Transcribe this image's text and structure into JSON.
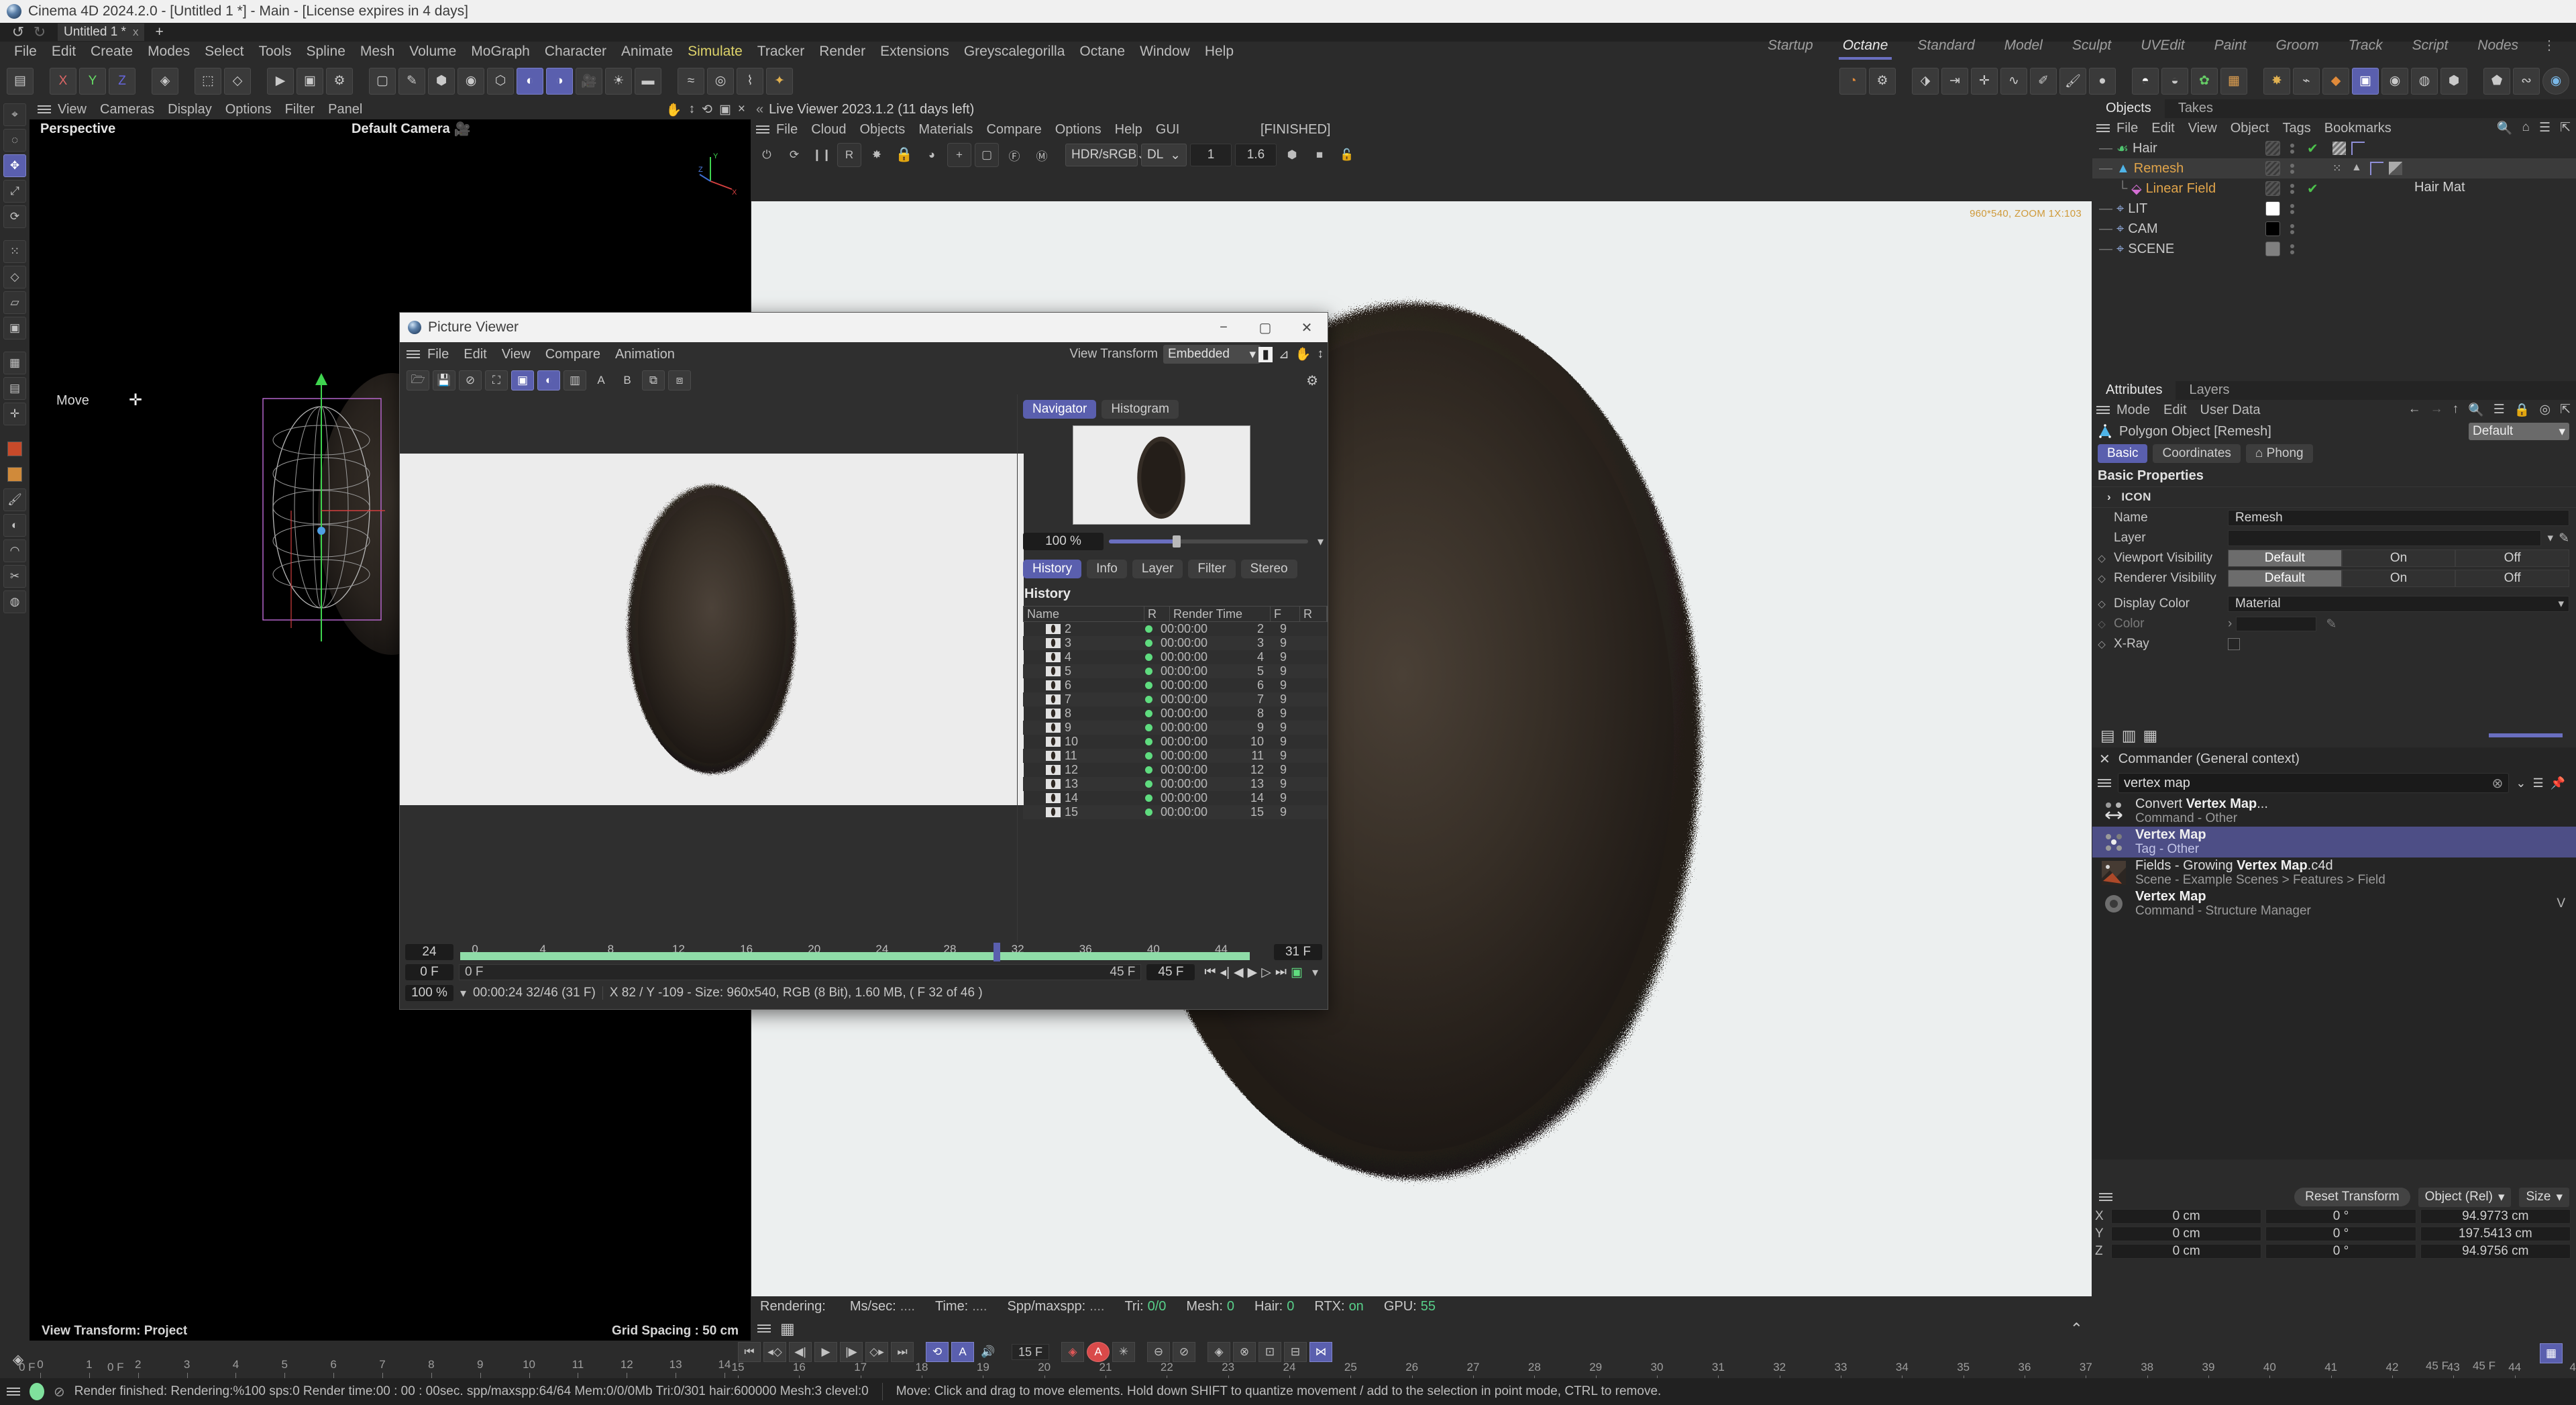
{
  "title_bar": {
    "text": "Cinema 4D 2024.2.0 - [Untitled 1 *] - Main - [License expires in 4 days]"
  },
  "doc_tabs": {
    "name": "Untitled 1 *",
    "close": "x",
    "add": "+",
    "undo": "↺",
    "redo": "↻"
  },
  "main_menu": [
    "File",
    "Edit",
    "Create",
    "Modes",
    "Select",
    "Tools",
    "Spline",
    "Mesh",
    "Volume",
    "MoGraph",
    "Character",
    "Animate",
    "Simulate",
    "Tracker",
    "Render",
    "Extensions",
    "Greyscalegorilla",
    "Octane",
    "Window",
    "Help"
  ],
  "main_menu_active": "Simulate",
  "layout_tabs": [
    "Startup",
    "Octane",
    "Standard",
    "Model",
    "Sculpt",
    "UVEdit",
    "Paint",
    "Groom",
    "Track",
    "Script",
    "Nodes"
  ],
  "layout_active": "Octane",
  "viewport": {
    "menu": [
      "View",
      "Cameras",
      "Display",
      "Options",
      "Filter",
      "Panel"
    ],
    "projection": "Perspective",
    "camera": "Default Camera",
    "tool_label": "Move",
    "view_transform": "View Transform: Project",
    "grid_spacing": "Grid Spacing : 50 cm"
  },
  "live_viewer": {
    "title": "Live Viewer 2023.1.2 (11 days left)",
    "menu": [
      "File",
      "Cloud",
      "Objects",
      "Materials",
      "Compare",
      "Options",
      "Help",
      "GUI"
    ],
    "status": "[FINISHED]",
    "color_space": "HDR/sRGB",
    "kernel": "DL",
    "num1": "1",
    "num2": "1.6",
    "watermark": "960*540, ZOOM 1X:103",
    "stats": {
      "rendering_label": "Rendering:",
      "rendering_value": "",
      "mssec_label": "Ms/sec:",
      "mssec_value": "....",
      "time_label": "Time:",
      "time_value": "....",
      "spp_label": "Spp/maxspp:",
      "spp_value": "....",
      "tri_label": "Tri:",
      "tri_value": "0/0",
      "mesh_label": "Mesh:",
      "mesh_value": "0",
      "hair_label": "Hair:",
      "hair_value": "0",
      "rtx_label": "RTX:",
      "rtx_value": "on",
      "gpu_label": "GPU:",
      "gpu_value": "55"
    }
  },
  "picture_viewer": {
    "window_title": "Picture Viewer",
    "menu": [
      "File",
      "Edit",
      "View",
      "Compare",
      "Animation"
    ],
    "view_transform_label": "View Transform",
    "view_transform_value": "Embedded",
    "nav_tabs": [
      "Navigator",
      "Histogram"
    ],
    "nav_active": "Navigator",
    "zoom_value": "100 %",
    "info_tabs": [
      "History",
      "Info",
      "Layer",
      "Filter",
      "Stereo"
    ],
    "info_active": "History",
    "history_title": "History",
    "history_columns": [
      "Name",
      "R",
      "Render Time",
      "F",
      "R"
    ],
    "history_rows": [
      {
        "name": "2",
        "time": "00:00:00",
        "f": "2",
        "r": "9"
      },
      {
        "name": "3",
        "time": "00:00:00",
        "f": "3",
        "r": "9"
      },
      {
        "name": "4",
        "time": "00:00:00",
        "f": "4",
        "r": "9"
      },
      {
        "name": "5",
        "time": "00:00:00",
        "f": "5",
        "r": "9"
      },
      {
        "name": "6",
        "time": "00:00:00",
        "f": "6",
        "r": "9"
      },
      {
        "name": "7",
        "time": "00:00:00",
        "f": "7",
        "r": "9"
      },
      {
        "name": "8",
        "time": "00:00:00",
        "f": "8",
        "r": "9"
      },
      {
        "name": "9",
        "time": "00:00:00",
        "f": "9",
        "r": "9"
      },
      {
        "name": "10",
        "time": "00:00:00",
        "f": "10",
        "r": "9"
      },
      {
        "name": "11",
        "time": "00:00:00",
        "f": "11",
        "r": "9"
      },
      {
        "name": "12",
        "time": "00:00:00",
        "f": "12",
        "r": "9"
      },
      {
        "name": "13",
        "time": "00:00:00",
        "f": "13",
        "r": "9"
      },
      {
        "name": "14",
        "time": "00:00:00",
        "f": "14",
        "r": "9"
      },
      {
        "name": "15",
        "time": "00:00:00",
        "f": "15",
        "r": "9"
      }
    ],
    "timeline": {
      "fps": "24",
      "current_frame": "31 F",
      "start": "0 F",
      "end": "45 F",
      "range_start": "0 F",
      "range_end": "45 F",
      "ticks": [
        "0",
        "4",
        "8",
        "12",
        "16",
        "20",
        "24",
        "28",
        "32",
        "36",
        "40",
        "44"
      ],
      "playhead_label": "31"
    },
    "status": {
      "zoom": "100 %",
      "time": "00:00:24 32/46 (31 F)",
      "info": "X 82 / Y -109 - Size: 960x540, RGB (8 Bit), 1.60 MB,  ( F 32 of 46 )"
    }
  },
  "object_manager": {
    "tabs": [
      "Objects",
      "Takes"
    ],
    "active_tab": "Objects",
    "menu": [
      "File",
      "Edit",
      "View",
      "Object",
      "Tags",
      "Bookmarks"
    ],
    "items": [
      {
        "name": "Hair",
        "indent": 0,
        "selected": false,
        "check": true,
        "swatch": "hatch"
      },
      {
        "name": "Remesh",
        "indent": 0,
        "selected": true,
        "check": false,
        "swatch": "hatch"
      },
      {
        "name": "Linear Field",
        "indent": 1,
        "selected": false,
        "check": true,
        "swatch": "hatch"
      },
      {
        "name": "LIT",
        "indent": 0,
        "selected": false,
        "check": false,
        "swatch": "#ffffff"
      },
      {
        "name": "CAM",
        "indent": 0,
        "selected": false,
        "check": false,
        "swatch": "#000000"
      },
      {
        "name": "SCENE",
        "indent": 0,
        "selected": false,
        "check": false,
        "swatch": "#808080"
      }
    ],
    "material_label": "Hair Mat"
  },
  "attributes": {
    "tabs": [
      "Attributes",
      "Layers"
    ],
    "active_tab": "Attributes",
    "menu": [
      "Mode",
      "Edit",
      "User Data"
    ],
    "object_title": "Polygon Object [Remesh]",
    "preset": "Default",
    "pills": [
      "Basic",
      "Coordinates",
      "Phong"
    ],
    "pill_active": "Basic",
    "section": "Basic Properties",
    "icon_section": "ICON",
    "rows": {
      "name_label": "Name",
      "name_value": "Remesh",
      "layer_label": "Layer",
      "layer_value": "",
      "viewport_vis_label": "Viewport Visibility",
      "renderer_vis_label": "Renderer Visibility",
      "seg_options": [
        "Default",
        "On",
        "Off"
      ],
      "seg_active": "Default",
      "display_color_label": "Display Color",
      "display_color_value": "Material",
      "color_label": "Color",
      "xray_label": "X-Ray"
    }
  },
  "commander": {
    "title": "Commander (General context)",
    "query": "vertex map",
    "results": [
      {
        "title_pre": "Convert ",
        "title_bold": "Vertex Map",
        "title_post": "...",
        "sub": "Command - Other",
        "selected": false,
        "icon": "convert",
        "shortcut": ""
      },
      {
        "title_pre": "",
        "title_bold": "Vertex Map",
        "title_post": "",
        "sub": "Tag - Other",
        "selected": true,
        "icon": "dots",
        "shortcut": ""
      },
      {
        "title_pre": "Fields - Growing ",
        "title_bold": "Vertex Map",
        "title_post": ".c4d",
        "sub": "Scene - Example Scenes > Features > Field",
        "selected": false,
        "icon": "thumb",
        "shortcut": ""
      },
      {
        "title_pre": "",
        "title_bold": "Vertex Map",
        "title_post": "",
        "sub": "Command - Structure Manager",
        "selected": false,
        "icon": "gear",
        "shortcut": "V"
      }
    ]
  },
  "coordinates": {
    "reset_label": "Reset Transform",
    "mode": "Object (Rel)",
    "size_mode": "Size",
    "axes": [
      "X",
      "Y",
      "Z"
    ],
    "position": [
      "0 cm",
      "0 cm",
      "0 cm"
    ],
    "rotation": [
      "0 °",
      "0 °",
      "0 °"
    ],
    "size": [
      "94.9773 cm",
      "197.5413 cm",
      "94.9756 cm"
    ]
  },
  "bottom_timeline": {
    "current_frame": "15 F",
    "start_left": "0 F",
    "start_right": "0 F",
    "end_left": "45 F",
    "end_right": "45 F",
    "ticks": [
      "0",
      "1",
      "2",
      "3",
      "4",
      "5",
      "6",
      "7",
      "8",
      "9",
      "10",
      "11",
      "12",
      "13",
      "14",
      "15",
      "16",
      "17",
      "18",
      "19",
      "20",
      "21",
      "22",
      "23",
      "24",
      "25",
      "26",
      "27",
      "28",
      "29",
      "30",
      "31",
      "32",
      "33",
      "34",
      "35",
      "36",
      "37",
      "38",
      "39",
      "40",
      "41",
      "42",
      "43",
      "44",
      "45"
    ]
  },
  "status_bar": {
    "render_text": "Render finished: Rendering:%100 sps:0 Render time:00 : 00 : 00sec. spp/maxspp:64/64 Mem:0/0/0Mb Tri:0/301 hair:600000 Mesh:3 clevel:0",
    "hint_text": "Move: Click and drag to move elements. Hold down SHIFT to quantize movement / add to the selection in point mode, CTRL to remove."
  }
}
